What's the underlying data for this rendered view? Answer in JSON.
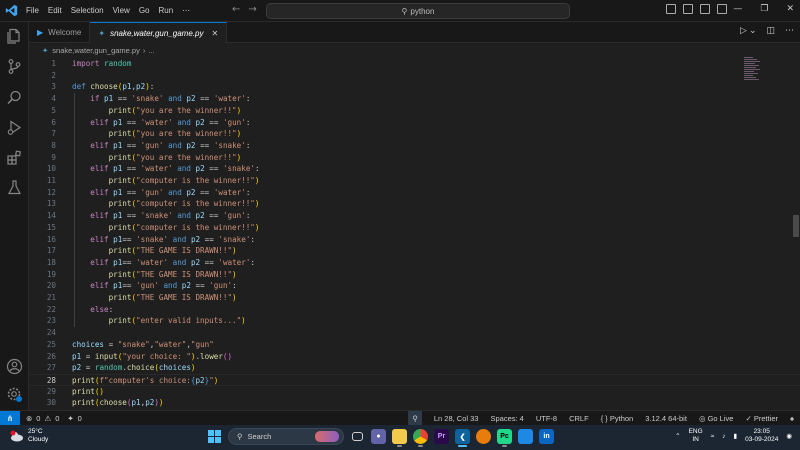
{
  "titlebar": {
    "menu": [
      "File",
      "Edit",
      "Selection",
      "View",
      "Go",
      "Run",
      "⋯"
    ],
    "search_text": "python"
  },
  "tabs": [
    {
      "label": "Welcome",
      "active": false
    },
    {
      "label": "snake,water,gun_game.py",
      "active": true
    }
  ],
  "breadcrumb": {
    "file": "snake,water,gun_game.py",
    "rest": "..."
  },
  "editor": {
    "current_line": 28,
    "lines": [
      {
        "n": "1",
        "tokens": [
          [
            "k",
            "import"
          ],
          [
            "p",
            " "
          ],
          [
            "mod",
            "random"
          ]
        ]
      },
      {
        "n": "2",
        "tokens": []
      },
      {
        "n": "3",
        "tokens": [
          [
            "kb",
            "def"
          ],
          [
            "p",
            " "
          ],
          [
            "fn",
            "choose"
          ],
          [
            "brk",
            "("
          ],
          [
            "v",
            "p1"
          ],
          [
            "p",
            ","
          ],
          [
            "v",
            "p2"
          ],
          [
            "brk",
            ")"
          ],
          [
            "p",
            ":"
          ]
        ]
      },
      {
        "n": "4",
        "tokens": [
          [
            "p",
            "    "
          ],
          [
            "k",
            "if"
          ],
          [
            "p",
            " "
          ],
          [
            "v",
            "p1"
          ],
          [
            "p",
            " == "
          ],
          [
            "s",
            "'snake'"
          ],
          [
            "p",
            " "
          ],
          [
            "kb",
            "and"
          ],
          [
            "p",
            " "
          ],
          [
            "v",
            "p2"
          ],
          [
            "p",
            " == "
          ],
          [
            "s",
            "'water'"
          ],
          [
            "p",
            ":"
          ]
        ]
      },
      {
        "n": "5",
        "tokens": [
          [
            "p",
            "        "
          ],
          [
            "fn",
            "print"
          ],
          [
            "brk",
            "("
          ],
          [
            "s",
            "\"you are the winner!!\""
          ],
          [
            "brk",
            ")"
          ]
        ]
      },
      {
        "n": "6",
        "tokens": [
          [
            "p",
            "    "
          ],
          [
            "k",
            "elif"
          ],
          [
            "p",
            " "
          ],
          [
            "v",
            "p1"
          ],
          [
            "p",
            " == "
          ],
          [
            "s",
            "'water'"
          ],
          [
            "p",
            " "
          ],
          [
            "kb",
            "and"
          ],
          [
            "p",
            " "
          ],
          [
            "v",
            "p2"
          ],
          [
            "p",
            " == "
          ],
          [
            "s",
            "'gun'"
          ],
          [
            "p",
            ":"
          ]
        ]
      },
      {
        "n": "7",
        "tokens": [
          [
            "p",
            "        "
          ],
          [
            "fn",
            "print"
          ],
          [
            "brk",
            "("
          ],
          [
            "s",
            "\"you are the winner!!\""
          ],
          [
            "brk",
            ")"
          ]
        ]
      },
      {
        "n": "8",
        "tokens": [
          [
            "p",
            "    "
          ],
          [
            "k",
            "elif"
          ],
          [
            "p",
            " "
          ],
          [
            "v",
            "p1"
          ],
          [
            "p",
            " == "
          ],
          [
            "s",
            "'gun'"
          ],
          [
            "p",
            " "
          ],
          [
            "kb",
            "and"
          ],
          [
            "p",
            " "
          ],
          [
            "v",
            "p2"
          ],
          [
            "p",
            " == "
          ],
          [
            "s",
            "'snake'"
          ],
          [
            "p",
            ":"
          ]
        ]
      },
      {
        "n": "9",
        "tokens": [
          [
            "p",
            "        "
          ],
          [
            "fn",
            "print"
          ],
          [
            "brk",
            "("
          ],
          [
            "s",
            "\"you are the winner!!\""
          ],
          [
            "brk",
            ")"
          ]
        ]
      },
      {
        "n": "10",
        "tokens": [
          [
            "p",
            "    "
          ],
          [
            "k",
            "elif"
          ],
          [
            "p",
            " "
          ],
          [
            "v",
            "p1"
          ],
          [
            "p",
            " == "
          ],
          [
            "s",
            "'water'"
          ],
          [
            "p",
            " "
          ],
          [
            "kb",
            "and"
          ],
          [
            "p",
            " "
          ],
          [
            "v",
            "p2"
          ],
          [
            "p",
            " == "
          ],
          [
            "s",
            "'snake'"
          ],
          [
            "p",
            ":"
          ]
        ]
      },
      {
        "n": "11",
        "tokens": [
          [
            "p",
            "        "
          ],
          [
            "fn",
            "print"
          ],
          [
            "brk",
            "("
          ],
          [
            "s",
            "\"computer is the winner!!\""
          ],
          [
            "brk",
            ")"
          ]
        ]
      },
      {
        "n": "12",
        "tokens": [
          [
            "p",
            "    "
          ],
          [
            "k",
            "elif"
          ],
          [
            "p",
            " "
          ],
          [
            "v",
            "p1"
          ],
          [
            "p",
            " == "
          ],
          [
            "s",
            "'gun'"
          ],
          [
            "p",
            " "
          ],
          [
            "kb",
            "and"
          ],
          [
            "p",
            " "
          ],
          [
            "v",
            "p2"
          ],
          [
            "p",
            " == "
          ],
          [
            "s",
            "'water'"
          ],
          [
            "p",
            ":"
          ]
        ]
      },
      {
        "n": "13",
        "tokens": [
          [
            "p",
            "        "
          ],
          [
            "fn",
            "print"
          ],
          [
            "brk",
            "("
          ],
          [
            "s",
            "\"computer is the winner!!\""
          ],
          [
            "brk",
            ")"
          ]
        ]
      },
      {
        "n": "14",
        "tokens": [
          [
            "p",
            "    "
          ],
          [
            "k",
            "elif"
          ],
          [
            "p",
            " "
          ],
          [
            "v",
            "p1"
          ],
          [
            "p",
            " == "
          ],
          [
            "s",
            "'snake'"
          ],
          [
            "p",
            " "
          ],
          [
            "kb",
            "and"
          ],
          [
            "p",
            " "
          ],
          [
            "v",
            "p2"
          ],
          [
            "p",
            " == "
          ],
          [
            "s",
            "'gun'"
          ],
          [
            "p",
            ":"
          ]
        ]
      },
      {
        "n": "15",
        "tokens": [
          [
            "p",
            "        "
          ],
          [
            "fn",
            "print"
          ],
          [
            "brk",
            "("
          ],
          [
            "s",
            "\"computer is the winner!!\""
          ],
          [
            "brk",
            ")"
          ]
        ]
      },
      {
        "n": "16",
        "tokens": [
          [
            "p",
            "    "
          ],
          [
            "k",
            "elif"
          ],
          [
            "p",
            " "
          ],
          [
            "v",
            "p1"
          ],
          [
            "p",
            "== "
          ],
          [
            "s",
            "'snake'"
          ],
          [
            "p",
            " "
          ],
          [
            "kb",
            "and"
          ],
          [
            "p",
            " "
          ],
          [
            "v",
            "p2"
          ],
          [
            "p",
            " == "
          ],
          [
            "s",
            "'snake'"
          ],
          [
            "p",
            ":"
          ]
        ]
      },
      {
        "n": "17",
        "tokens": [
          [
            "p",
            "        "
          ],
          [
            "fn",
            "print"
          ],
          [
            "brk",
            "("
          ],
          [
            "s",
            "\"THE GAME IS DRAWN!!\""
          ],
          [
            "brk",
            ")"
          ]
        ]
      },
      {
        "n": "18",
        "tokens": [
          [
            "p",
            "    "
          ],
          [
            "k",
            "elif"
          ],
          [
            "p",
            " "
          ],
          [
            "v",
            "p1"
          ],
          [
            "p",
            "== "
          ],
          [
            "s",
            "'water'"
          ],
          [
            "p",
            " "
          ],
          [
            "kb",
            "and"
          ],
          [
            "p",
            " "
          ],
          [
            "v",
            "p2"
          ],
          [
            "p",
            " == "
          ],
          [
            "s",
            "'water'"
          ],
          [
            "p",
            ":"
          ]
        ]
      },
      {
        "n": "19",
        "tokens": [
          [
            "p",
            "        "
          ],
          [
            "fn",
            "print"
          ],
          [
            "brk",
            "("
          ],
          [
            "s",
            "\"THE GAME IS DRAWN!!\""
          ],
          [
            "brk",
            ")"
          ]
        ]
      },
      {
        "n": "20",
        "tokens": [
          [
            "p",
            "    "
          ],
          [
            "k",
            "elif"
          ],
          [
            "p",
            " "
          ],
          [
            "v",
            "p1"
          ],
          [
            "p",
            "== "
          ],
          [
            "s",
            "'gun'"
          ],
          [
            "p",
            " "
          ],
          [
            "kb",
            "and"
          ],
          [
            "p",
            " "
          ],
          [
            "v",
            "p2"
          ],
          [
            "p",
            " == "
          ],
          [
            "s",
            "'gun'"
          ],
          [
            "p",
            ":"
          ]
        ]
      },
      {
        "n": "21",
        "tokens": [
          [
            "p",
            "        "
          ],
          [
            "fn",
            "print"
          ],
          [
            "brk",
            "("
          ],
          [
            "s",
            "\"THE GAME IS DRAWN!!\""
          ],
          [
            "brk",
            ")"
          ]
        ]
      },
      {
        "n": "22",
        "tokens": [
          [
            "p",
            "    "
          ],
          [
            "k",
            "else"
          ],
          [
            "p",
            ":"
          ]
        ]
      },
      {
        "n": "23",
        "tokens": [
          [
            "p",
            "        "
          ],
          [
            "fn",
            "print"
          ],
          [
            "brk",
            "("
          ],
          [
            "s",
            "\"enter valid inputs...\""
          ],
          [
            "brk",
            ")"
          ]
        ]
      },
      {
        "n": "24",
        "tokens": []
      },
      {
        "n": "25",
        "tokens": [
          [
            "v",
            "choices"
          ],
          [
            "p",
            " = "
          ],
          [
            "s",
            "\"snake\""
          ],
          [
            "p",
            ","
          ],
          [
            "s",
            "\"water\""
          ],
          [
            "p",
            ","
          ],
          [
            "s",
            "\"gun\""
          ]
        ]
      },
      {
        "n": "26",
        "tokens": [
          [
            "v",
            "p1"
          ],
          [
            "p",
            " = "
          ],
          [
            "fn",
            "input"
          ],
          [
            "brk",
            "("
          ],
          [
            "s",
            "\"your choice: \""
          ],
          [
            "brk",
            ")"
          ],
          [
            "p",
            "."
          ],
          [
            "fn",
            "lower"
          ],
          [
            "brk2",
            "()"
          ]
        ]
      },
      {
        "n": "27",
        "tokens": [
          [
            "v",
            "p2"
          ],
          [
            "p",
            " = "
          ],
          [
            "mod",
            "random"
          ],
          [
            "p",
            "."
          ],
          [
            "fn",
            "choice"
          ],
          [
            "brk",
            "("
          ],
          [
            "v",
            "choices"
          ],
          [
            "brk",
            ")"
          ]
        ]
      },
      {
        "n": "28",
        "tokens": [
          [
            "fn",
            "print"
          ],
          [
            "brk",
            "("
          ],
          [
            "s",
            "f\"computer's choice:"
          ],
          [
            "kb",
            "{"
          ],
          [
            "v",
            "p2"
          ],
          [
            "kb",
            "}"
          ],
          [
            "s",
            "\""
          ],
          [
            "brk",
            ")"
          ]
        ]
      },
      {
        "n": "29",
        "tokens": [
          [
            "fn",
            "print"
          ],
          [
            "brk",
            "()"
          ]
        ]
      },
      {
        "n": "30",
        "tokens": [
          [
            "fn",
            "print"
          ],
          [
            "brk",
            "("
          ],
          [
            "fn",
            "choose"
          ],
          [
            "brk2",
            "("
          ],
          [
            "v",
            "p1"
          ],
          [
            "p",
            ","
          ],
          [
            "v",
            "p2"
          ],
          [
            "brk2",
            ")"
          ],
          [
            "brk",
            ")"
          ]
        ]
      }
    ]
  },
  "statusbar": {
    "errors": "0",
    "warnings": "0",
    "ports": "0",
    "position": "Ln 28, Col 33",
    "spaces": "Spaces: 4",
    "encoding": "UTF-8",
    "eol": "CRLF",
    "language": "Python",
    "interpreter": "3.12.4 64-bit",
    "golive": "Go Live",
    "prettier": "Prettier"
  },
  "taskbar": {
    "temp": "25°C",
    "weather": "Cloudy",
    "search_label": "Search",
    "lang": "ENG",
    "region": "IN",
    "time": "23:05",
    "date": "03-09-2024"
  },
  "colors": {
    "accent": "#0078d4",
    "editor_bg": "#1f1f1f",
    "chrome_bg": "#181818"
  }
}
